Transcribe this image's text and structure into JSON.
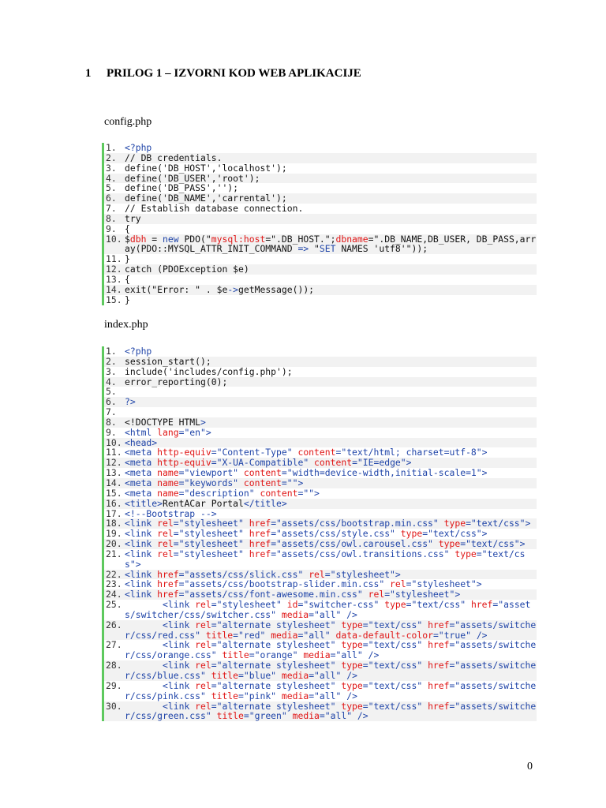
{
  "heading": {
    "number": "1",
    "title": "PRILOG  1 – IZVORNI KOD WEB APLIKACIJE"
  },
  "page_number": "0",
  "code_blocks": [
    {
      "filename": "config.php",
      "lines": [
        [
          [
            "<?php",
            "b"
          ]
        ],
        [
          [
            "// DB credentials.",
            "k"
          ]
        ],
        [
          [
            "define('DB_HOST','localhost');",
            "k"
          ]
        ],
        [
          [
            "define('DB_USER','root');",
            "k"
          ]
        ],
        [
          [
            "define('DB_PASS','');",
            "k"
          ]
        ],
        [
          [
            "define('DB_NAME','carrental');",
            "k"
          ]
        ],
        [
          [
            "// Establish database connection.",
            "k"
          ]
        ],
        [
          [
            "try",
            "k"
          ]
        ],
        [
          [
            "{",
            "k"
          ]
        ],
        [
          [
            "$",
            "k"
          ],
          [
            "dbh",
            "r"
          ],
          [
            " = ",
            "k"
          ],
          [
            "new",
            "b"
          ],
          [
            " PDO(\"",
            "k"
          ],
          [
            "mysql:host",
            "r"
          ],
          [
            "=\".DB_HOST.\";",
            "k"
          ],
          [
            "dbname",
            "r"
          ],
          [
            "=\".DB_NAME,DB_USER, DB_PASS,array(PDO::MYSQL_ATTR_INIT_COMMAND ",
            "k"
          ],
          [
            "=>",
            "b"
          ],
          [
            " \"",
            "k"
          ],
          [
            "SET",
            "b"
          ],
          [
            " NAMES 'utf8'\"));",
            "k"
          ]
        ],
        [
          [
            "}",
            "k"
          ]
        ],
        [
          [
            "catch (PDOException $e)",
            "k"
          ]
        ],
        [
          [
            "{",
            "k"
          ]
        ],
        [
          [
            "exit(\"Error: \" . $e",
            "k"
          ],
          [
            "->",
            "b"
          ],
          [
            "getMessage());",
            "k"
          ]
        ],
        [
          [
            "}",
            "k"
          ]
        ]
      ]
    },
    {
      "filename": "index.php",
      "lines": [
        [
          [
            "<?php",
            "b"
          ]
        ],
        [
          [
            "session_start();",
            "k"
          ]
        ],
        [
          [
            "include('includes/config.php');",
            "k"
          ]
        ],
        [
          [
            "error_reporting(0);",
            "k"
          ]
        ],
        [
          [
            "",
            "k"
          ]
        ],
        [
          [
            "?>",
            "b"
          ]
        ],
        [
          [
            "",
            "k"
          ]
        ],
        [
          [
            "<!DOCTYPE HTML",
            "k"
          ],
          [
            ">",
            "b"
          ]
        ],
        [
          [
            "<html ",
            "b"
          ],
          [
            "lang",
            "r"
          ],
          [
            "=\"en\">",
            "b"
          ]
        ],
        [
          [
            "<head>",
            "b"
          ]
        ],
        [
          [
            "<meta ",
            "b"
          ],
          [
            "http-equiv",
            "r"
          ],
          [
            "=\"Content-Type\" ",
            "b"
          ],
          [
            "content",
            "r"
          ],
          [
            "=\"text/html; charset=utf-8\">",
            "b"
          ]
        ],
        [
          [
            "<meta ",
            "b"
          ],
          [
            "http-equiv",
            "r"
          ],
          [
            "=\"X-UA-Compatible\" ",
            "b"
          ],
          [
            "content",
            "r"
          ],
          [
            "=\"IE=edge\">",
            "b"
          ]
        ],
        [
          [
            "<meta ",
            "b"
          ],
          [
            "name",
            "r"
          ],
          [
            "=\"viewport\" ",
            "b"
          ],
          [
            "content",
            "r"
          ],
          [
            "=\"width=device-width,initial-scale=1\">",
            "b"
          ]
        ],
        [
          [
            "<meta ",
            "b"
          ],
          [
            "name",
            "r"
          ],
          [
            "=\"keywords\" ",
            "b"
          ],
          [
            "content",
            "r"
          ],
          [
            "=\"\">",
            "b"
          ]
        ],
        [
          [
            "<meta ",
            "b"
          ],
          [
            "name",
            "r"
          ],
          [
            "=\"description\" ",
            "b"
          ],
          [
            "content",
            "r"
          ],
          [
            "=\"\">",
            "b"
          ]
        ],
        [
          [
            "<title>",
            "b"
          ],
          [
            "RentACar Portal",
            "k"
          ],
          [
            "</title>",
            "b"
          ]
        ],
        [
          [
            "<!--Bootstrap -->",
            "b"
          ]
        ],
        [
          [
            "<link ",
            "b"
          ],
          [
            "rel",
            "r"
          ],
          [
            "=\"stylesheet\" ",
            "b"
          ],
          [
            "href",
            "r"
          ],
          [
            "=\"assets/css/bootstrap.min.css\" ",
            "b"
          ],
          [
            "type",
            "r"
          ],
          [
            "=\"text/css\">",
            "b"
          ]
        ],
        [
          [
            "<link ",
            "b"
          ],
          [
            "rel",
            "r"
          ],
          [
            "=\"stylesheet\" ",
            "b"
          ],
          [
            "href",
            "r"
          ],
          [
            "=\"assets/css/style.css\" ",
            "b"
          ],
          [
            "type",
            "r"
          ],
          [
            "=\"text/css\">",
            "b"
          ]
        ],
        [
          [
            "<link ",
            "b"
          ],
          [
            "rel",
            "r"
          ],
          [
            "=\"stylesheet\" ",
            "b"
          ],
          [
            "href",
            "r"
          ],
          [
            "=\"assets/css/owl.carousel.css\" ",
            "b"
          ],
          [
            "type",
            "r"
          ],
          [
            "=\"text/css\">",
            "b"
          ]
        ],
        [
          [
            "<link ",
            "b"
          ],
          [
            "rel",
            "r"
          ],
          [
            "=\"stylesheet\" ",
            "b"
          ],
          [
            "href",
            "r"
          ],
          [
            "=\"assets/css/owl.transitions.css\" ",
            "b"
          ],
          [
            "type",
            "r"
          ],
          [
            "=\"text/css\">",
            "b"
          ]
        ],
        [
          [
            "<link ",
            "b"
          ],
          [
            "href",
            "r"
          ],
          [
            "=\"assets/css/slick.css\" ",
            "b"
          ],
          [
            "rel",
            "r"
          ],
          [
            "=\"stylesheet\">",
            "b"
          ]
        ],
        [
          [
            "<link ",
            "b"
          ],
          [
            "href",
            "r"
          ],
          [
            "=\"assets/css/bootstrap-slider.min.css\" ",
            "b"
          ],
          [
            "rel",
            "r"
          ],
          [
            "=\"stylesheet\">",
            "b"
          ]
        ],
        [
          [
            "<link ",
            "b"
          ],
          [
            "href",
            "r"
          ],
          [
            "=\"assets/css/font-awesome.min.css\" ",
            "b"
          ],
          [
            "rel",
            "r"
          ],
          [
            "=\"stylesheet\">",
            "b"
          ]
        ],
        [
          [
            "       <link ",
            "b"
          ],
          [
            "rel",
            "r"
          ],
          [
            "=\"stylesheet\" ",
            "b"
          ],
          [
            "id",
            "r"
          ],
          [
            "=\"switcher-css\" ",
            "b"
          ],
          [
            "type",
            "r"
          ],
          [
            "=\"text/css\" ",
            "b"
          ],
          [
            "href",
            "r"
          ],
          [
            "=\"assets/switcher/css/switcher.css\" ",
            "b"
          ],
          [
            "media",
            "r"
          ],
          [
            "=\"all\" />",
            "b"
          ]
        ],
        [
          [
            "       <link ",
            "b"
          ],
          [
            "rel",
            "r"
          ],
          [
            "=\"alternate stylesheet\" ",
            "b"
          ],
          [
            "type",
            "r"
          ],
          [
            "=\"text/css\" ",
            "b"
          ],
          [
            "href",
            "r"
          ],
          [
            "=\"assets/switcher/css/red.css\" ",
            "b"
          ],
          [
            "title",
            "r"
          ],
          [
            "=\"red\" ",
            "b"
          ],
          [
            "media",
            "r"
          ],
          [
            "=\"all\" ",
            "b"
          ],
          [
            "data-default-color",
            "r"
          ],
          [
            "=\"true\" />",
            "b"
          ]
        ],
        [
          [
            "       <link ",
            "b"
          ],
          [
            "rel",
            "r"
          ],
          [
            "=\"alternate stylesheet\" ",
            "b"
          ],
          [
            "type",
            "r"
          ],
          [
            "=\"text/css\" ",
            "b"
          ],
          [
            "href",
            "r"
          ],
          [
            "=\"assets/switcher/css/orange.css\" ",
            "b"
          ],
          [
            "title",
            "r"
          ],
          [
            "=\"orange\" ",
            "b"
          ],
          [
            "media",
            "r"
          ],
          [
            "=\"all\" />",
            "b"
          ]
        ],
        [
          [
            "       <link ",
            "b"
          ],
          [
            "rel",
            "r"
          ],
          [
            "=\"alternate stylesheet\" ",
            "b"
          ],
          [
            "type",
            "r"
          ],
          [
            "=\"text/css\" ",
            "b"
          ],
          [
            "href",
            "r"
          ],
          [
            "=\"assets/switcher/css/blue.css\" ",
            "b"
          ],
          [
            "title",
            "r"
          ],
          [
            "=\"blue\" ",
            "b"
          ],
          [
            "media",
            "r"
          ],
          [
            "=\"all\" />",
            "b"
          ]
        ],
        [
          [
            "       <link ",
            "b"
          ],
          [
            "rel",
            "r"
          ],
          [
            "=\"alternate stylesheet\" ",
            "b"
          ],
          [
            "type",
            "r"
          ],
          [
            "=\"text/css\" ",
            "b"
          ],
          [
            "href",
            "r"
          ],
          [
            "=\"assets/switcher/css/pink.css\" ",
            "b"
          ],
          [
            "title",
            "r"
          ],
          [
            "=\"pink\" ",
            "b"
          ],
          [
            "media",
            "r"
          ],
          [
            "=\"all\" />",
            "b"
          ]
        ],
        [
          [
            "       <link ",
            "b"
          ],
          [
            "rel",
            "r"
          ],
          [
            "=\"alternate stylesheet\" ",
            "b"
          ],
          [
            "type",
            "r"
          ],
          [
            "=\"text/css\" ",
            "b"
          ],
          [
            "href",
            "r"
          ],
          [
            "=\"assets/switcher/css/green.css\" ",
            "b"
          ],
          [
            "title",
            "r"
          ],
          [
            "=\"green\" ",
            "b"
          ],
          [
            "media",
            "r"
          ],
          [
            "=\"all\" />",
            "b"
          ]
        ]
      ]
    }
  ]
}
